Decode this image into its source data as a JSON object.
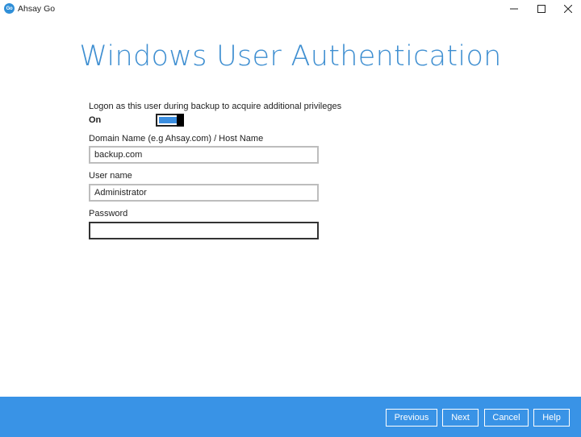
{
  "window": {
    "app_title": "Ahsay Go",
    "logo_text": "Go",
    "icons": [
      "minimize-icon",
      "maximize-icon",
      "close-icon"
    ]
  },
  "main": {
    "heading": "Windows User Authentication",
    "logon_label": "Logon as this user during backup to acquire additional privileges",
    "toggle": {
      "state_label": "On",
      "checked": true,
      "accent": "#3b8ee0"
    },
    "domain": {
      "label": "Domain Name (e.g Ahsay.com) / Host Name",
      "value": "backup.com"
    },
    "username": {
      "label": "User name",
      "value": "Administrator"
    },
    "password": {
      "label": "Password",
      "value": ""
    }
  },
  "footer": {
    "background": "#3993e6",
    "previous_label": "Previous",
    "next_label": "Next",
    "cancel_label": "Cancel",
    "help_label": "Help"
  }
}
